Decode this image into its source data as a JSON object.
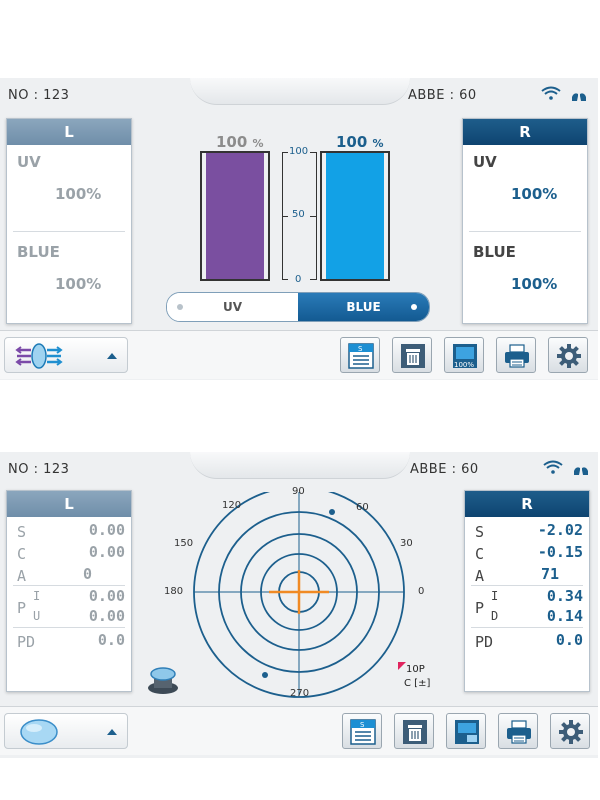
{
  "screen1": {
    "header": {
      "no_label": "NO : 123",
      "abbe_label": "ABBE : 60"
    },
    "left_panel": {
      "title": "L",
      "uv_label": "UV",
      "uv_value": "100%",
      "blue_label": "BLUE",
      "blue_value": "100%"
    },
    "right_panel": {
      "title": "R",
      "uv_label": "UV",
      "uv_value": "100%",
      "blue_label": "BLUE",
      "blue_value": "100%"
    },
    "bars": {
      "uv": {
        "value": "100",
        "unit": "%",
        "fill_fraction": 1.0,
        "color": "#7a4fa0"
      },
      "blue": {
        "value": "100",
        "unit": "%",
        "fill_fraction": 1.0,
        "color": "#12a1e6"
      },
      "ticks": [
        "100",
        "50",
        "0"
      ]
    },
    "toggle": {
      "uv_label": "UV",
      "blue_label": "BLUE",
      "selected": "BLUE"
    },
    "toolbar": {
      "tool3_label": "100%"
    },
    "icons": [
      "wifi-icon",
      "lungs-icon",
      "uv-blue-filter-icon",
      "save-sheet-icon",
      "trash-icon",
      "percent-display-icon",
      "printer-icon",
      "gear-icon"
    ]
  },
  "screen2": {
    "header": {
      "no_label": "NO : 123",
      "abbe_label": "ABBE : 60"
    },
    "left_panel": {
      "title": "L",
      "s_label": "S",
      "s_value": "0.00",
      "c_label": "C",
      "c_value": "0.00",
      "a_label": "A",
      "a_value": "0",
      "p_label": "P",
      "pi_label": "I",
      "pi_value": "0.00",
      "pu_label": "U",
      "pu_value": "0.00",
      "pd_label": "PD",
      "pd_value": "0.0"
    },
    "right_panel": {
      "title": "R",
      "s_label": "S",
      "s_value": "-2.02",
      "c_label": "C",
      "c_value": "-0.15",
      "a_label": "A",
      "a_value": "71",
      "p_label": "P",
      "pi_label": "I",
      "pi_value": "0.34",
      "pd_sub_label": "D",
      "pd_sub_value": "0.14",
      "pd_label": "PD",
      "pd_value": "0.0"
    },
    "target": {
      "deg_90": "90",
      "deg_120": "120",
      "deg_60": "60",
      "deg_150": "150",
      "deg_30": "30",
      "deg_180": "180",
      "deg_0": "0",
      "deg_270": "270"
    },
    "legend": {
      "prism_label": "10P",
      "cyl_label": "C [±]"
    },
    "icons": [
      "wifi-icon",
      "lungs-icon",
      "lens-cap-icon",
      "lens-icon",
      "save-sheet-icon",
      "trash-icon",
      "display-icon",
      "printer-icon",
      "gear-icon"
    ]
  }
}
